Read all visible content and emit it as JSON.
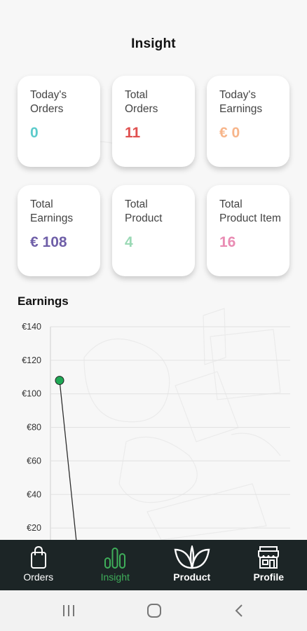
{
  "header": {
    "title": "Insight"
  },
  "cards": [
    {
      "label": "Today's\nOrders",
      "value": "0",
      "color": "#5ccbcb"
    },
    {
      "label": "Total\nOrders",
      "value": "11",
      "color": "#e0504f"
    },
    {
      "label": "Today's\nEarnings",
      "value": "€ 0",
      "color": "#f7b58a"
    },
    {
      "label": "Total\nEarnings",
      "value": "€ 108",
      "color": "#6f5fa8"
    },
    {
      "label": "Total\nProduct",
      "value": "4",
      "color": "#9ad9b5"
    },
    {
      "label": "Total\nProduct Item",
      "value": "16",
      "color": "#e98bb3"
    }
  ],
  "earnings": {
    "title": "Earnings"
  },
  "chart_data": {
    "type": "line",
    "title": "Earnings",
    "yticks": [
      "€140",
      "€120",
      "€100",
      "€80",
      "€60",
      "€40",
      "€20"
    ],
    "ylim": [
      0,
      140
    ],
    "grid": true,
    "series": [
      {
        "values": [
          108,
          0
        ],
        "color": "#2e2e2e",
        "marker_color": "#1fa855"
      }
    ]
  },
  "bottom_nav": {
    "items": [
      {
        "label": "Orders",
        "icon": "shopping-bag-icon",
        "active": false
      },
      {
        "label": "Insight",
        "icon": "bar-chart-icon",
        "active": true
      },
      {
        "label": "Product",
        "icon": "leaf-icon",
        "active": false
      },
      {
        "label": "Profile",
        "icon": "store-icon",
        "active": false
      }
    ],
    "active_color": "#3fae5a",
    "background": "#1c2526"
  },
  "system_nav": {
    "buttons": [
      "recent-apps-icon",
      "home-icon",
      "back-icon"
    ]
  }
}
